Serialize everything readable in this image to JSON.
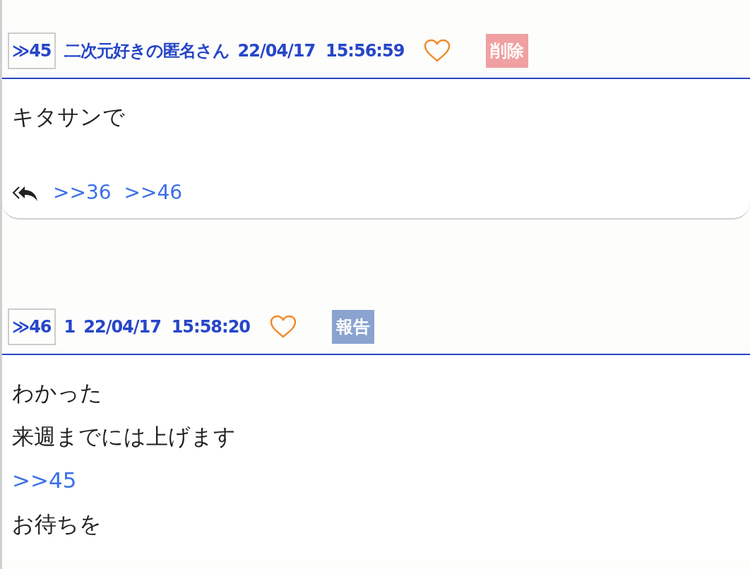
{
  "posts": [
    {
      "number": "≫45",
      "name": "二次元好きの匿名さん",
      "date": "22/04/17  15:56:59",
      "liked": false,
      "action": {
        "kind": "delete",
        "label": "削除"
      },
      "body": [
        {
          "kind": "text",
          "text": "キタサンで"
        }
      ],
      "replies": [
        ">>36",
        ">>46"
      ]
    },
    {
      "number": "≫46",
      "name": "1",
      "date": "22/04/17  15:58:20",
      "liked": false,
      "action": {
        "kind": "report",
        "label": "報告"
      },
      "body": [
        {
          "kind": "text",
          "text": "わかった"
        },
        {
          "kind": "text",
          "text": "来週までには上げます"
        },
        {
          "kind": "anchor",
          "text": ">>45"
        },
        {
          "kind": "text",
          "text": "お待ちを"
        }
      ]
    }
  ]
}
